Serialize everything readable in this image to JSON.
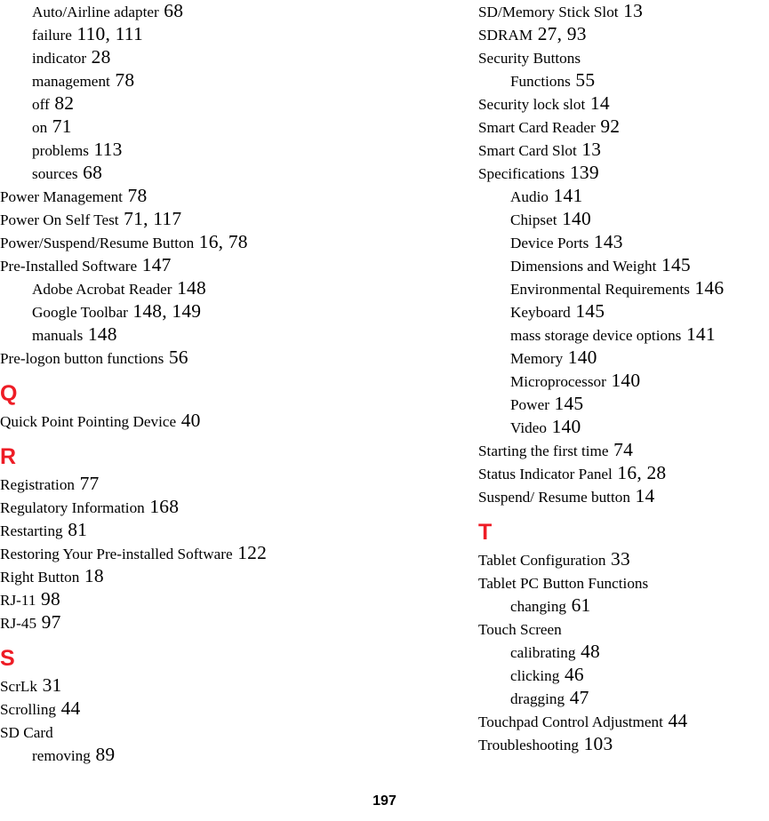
{
  "document": {
    "type": "book-index",
    "page_number": "197",
    "section_letter_color": "#ee1c25",
    "text_color": "#000000",
    "background_color": "#ffffff"
  },
  "columns": [
    {
      "name": "left-column",
      "blocks": [
        {
          "kind": "entries",
          "entries": [
            {
              "level": 1,
              "term": "Auto/Airline adapter",
              "pages": "68"
            },
            {
              "level": 1,
              "term": "failure",
              "pages": "110, 111"
            },
            {
              "level": 1,
              "term": "indicator",
              "pages": "28"
            },
            {
              "level": 1,
              "term": "management",
              "pages": "78"
            },
            {
              "level": 1,
              "term": "off",
              "pages": "82"
            },
            {
              "level": 1,
              "term": "on",
              "pages": "71"
            },
            {
              "level": 1,
              "term": "problems",
              "pages": "113"
            },
            {
              "level": 1,
              "term": "sources",
              "pages": "68"
            },
            {
              "level": 0,
              "term": "Power Management",
              "pages": "78"
            },
            {
              "level": 0,
              "term": "Power On Self Test",
              "pages": "71, 117"
            },
            {
              "level": 0,
              "term": "Power/Suspend/Resume Button",
              "pages": "16, 78"
            },
            {
              "level": 0,
              "term": "Pre-Installed Software",
              "pages": "147"
            },
            {
              "level": 1,
              "term": "Adobe Acrobat Reader",
              "pages": "148"
            },
            {
              "level": 1,
              "term": "Google Toolbar",
              "pages": "148, 149"
            },
            {
              "level": 1,
              "term": "manuals",
              "pages": "148"
            },
            {
              "level": 0,
              "term": "Pre-logon button functions",
              "pages": "56"
            }
          ]
        },
        {
          "kind": "section",
          "letter": "Q"
        },
        {
          "kind": "entries",
          "entries": [
            {
              "level": 0,
              "term": "Quick Point Pointing Device",
              "pages": "40"
            }
          ]
        },
        {
          "kind": "section",
          "letter": "R"
        },
        {
          "kind": "entries",
          "entries": [
            {
              "level": 0,
              "term": "Registration",
              "pages": "77"
            },
            {
              "level": 0,
              "term": "Regulatory Information",
              "pages": "168"
            },
            {
              "level": 0,
              "term": "Restarting",
              "pages": "81"
            },
            {
              "level": 0,
              "term": "Restoring Your Pre-installed Software",
              "pages": "122"
            },
            {
              "level": 0,
              "term": "Right Button",
              "pages": "18"
            },
            {
              "level": 0,
              "term": "RJ-11",
              "pages": "98"
            },
            {
              "level": 0,
              "term": "RJ-45",
              "pages": "97"
            }
          ]
        },
        {
          "kind": "section",
          "letter": "S"
        },
        {
          "kind": "entries",
          "entries": [
            {
              "level": 0,
              "term": "ScrLk",
              "pages": "31"
            },
            {
              "level": 0,
              "term": "Scrolling",
              "pages": "44"
            },
            {
              "level": 0,
              "term": "SD Card",
              "pages": ""
            },
            {
              "level": 1,
              "term": "removing",
              "pages": "89"
            }
          ]
        }
      ]
    },
    {
      "name": "right-column",
      "blocks": [
        {
          "kind": "entries",
          "entries": [
            {
              "level": 0,
              "term": "SD/Memory Stick Slot",
              "pages": "13"
            },
            {
              "level": 0,
              "term": "SDRAM",
              "pages": "27, 93"
            },
            {
              "level": 0,
              "term": "Security Buttons",
              "pages": ""
            },
            {
              "level": 1,
              "term": "Functions",
              "pages": "55"
            },
            {
              "level": 0,
              "term": "Security lock slot",
              "pages": "14"
            },
            {
              "level": 0,
              "term": "Smart Card Reader",
              "pages": "92"
            },
            {
              "level": 0,
              "term": "Smart Card Slot",
              "pages": "13"
            },
            {
              "level": 0,
              "term": "Specifications",
              "pages": "139"
            },
            {
              "level": 1,
              "term": "Audio",
              "pages": "141"
            },
            {
              "level": 1,
              "term": "Chipset",
              "pages": "140"
            },
            {
              "level": 1,
              "term": "Device Ports",
              "pages": "143"
            },
            {
              "level": 1,
              "term": "Dimensions and Weight",
              "pages": "145"
            },
            {
              "level": 1,
              "term": "Environmental Requirements",
              "pages": "146"
            },
            {
              "level": 1,
              "term": "Keyboard",
              "pages": "145"
            },
            {
              "level": 1,
              "term": "mass storage device options",
              "pages": "141"
            },
            {
              "level": 1,
              "term": "Memory",
              "pages": "140"
            },
            {
              "level": 1,
              "term": "Microprocessor",
              "pages": "140"
            },
            {
              "level": 1,
              "term": "Power",
              "pages": "145"
            },
            {
              "level": 1,
              "term": "Video",
              "pages": "140"
            },
            {
              "level": 0,
              "term": "Starting the first time",
              "pages": "74"
            },
            {
              "level": 0,
              "term": "Status Indicator Panel",
              "pages": "16, 28"
            },
            {
              "level": 0,
              "term": "Suspend/ Resume button",
              "pages": "14"
            }
          ]
        },
        {
          "kind": "section",
          "letter": "T"
        },
        {
          "kind": "entries",
          "entries": [
            {
              "level": 0,
              "term": "Tablet Configuration",
              "pages": "33"
            },
            {
              "level": 0,
              "term": "Tablet PC Button Functions",
              "pages": ""
            },
            {
              "level": 1,
              "term": "changing",
              "pages": "61"
            },
            {
              "level": 0,
              "term": "Touch Screen",
              "pages": ""
            },
            {
              "level": 1,
              "term": "calibrating",
              "pages": "48"
            },
            {
              "level": 1,
              "term": "clicking",
              "pages": "46"
            },
            {
              "level": 1,
              "term": "dragging",
              "pages": "47"
            },
            {
              "level": 0,
              "term": "Touchpad Control Adjustment",
              "pages": "44"
            },
            {
              "level": 0,
              "term": "Troubleshooting",
              "pages": "103"
            }
          ]
        }
      ]
    }
  ]
}
